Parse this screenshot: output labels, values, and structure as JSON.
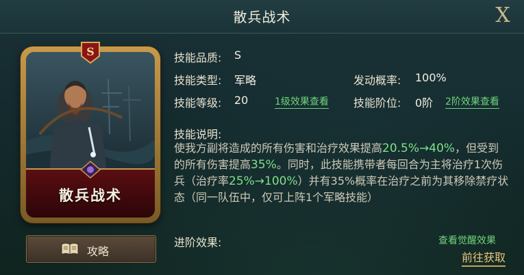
{
  "window": {
    "title": "散兵战术",
    "close_label": "X"
  },
  "card": {
    "name": "散兵战术",
    "rank_letter": "S"
  },
  "guide_button": {
    "label": "攻略"
  },
  "skill": {
    "quality_label": "技能品质:",
    "quality_value": "S",
    "type_label": "技能类型:",
    "type_value": "军略",
    "trigger_label": "发动概率:",
    "trigger_value": "100%",
    "level_label": "技能等级:",
    "level_value": "20",
    "level_link": "1级效果查看",
    "stage_label": "技能阶位:",
    "stage_value": "0阶",
    "stage_link": "2阶效果查看",
    "desc_label": "技能说明:",
    "desc": {
      "p1": "使我方副将造成的所有伤害和治疗效果提高",
      "h1": "20.5%→40%",
      "p2": "，但受到的所有伤害提高",
      "h2": "35%",
      "p3": "。同时，此技能携带者每回合为主将治疗1次伤兵（治疗率",
      "h3": "25%→100%",
      "p4": "）并有35%概率在治疗之前为其移除禁疗状态（同一队伍中，仅可上阵1个军略技能）"
    },
    "advance_label": "进阶效果:",
    "awake_link": "查看觉醒效果",
    "goto_label": "前往获取"
  },
  "colors": {
    "highlight": "#7ee08a",
    "gold": "#c79a4b",
    "banner": "#5a0e12"
  }
}
